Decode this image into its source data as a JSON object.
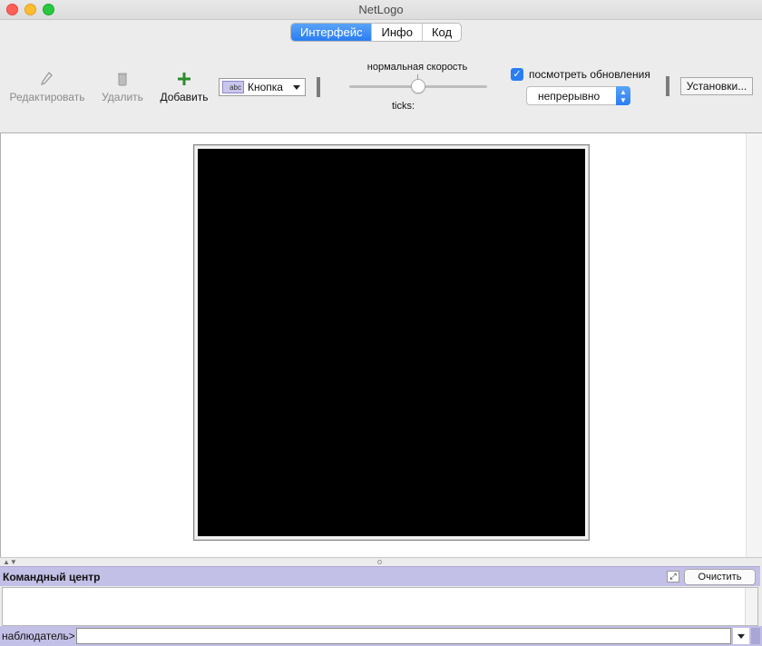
{
  "window": {
    "title": "NetLogo"
  },
  "tabs": [
    {
      "label": "Интерфейс",
      "active": true
    },
    {
      "label": "Инфо",
      "active": false
    },
    {
      "label": "Код",
      "active": false
    }
  ],
  "toolbar": {
    "edit_label": "Редактировать",
    "delete_label": "Удалить",
    "add_label": "Добавить",
    "widget_type": "Кнопка",
    "widget_type_icon_text": "abc",
    "speed_label": "нормальная скорость",
    "speed_value": 0.5,
    "ticks_label": "ticks:",
    "view_updates_label": "посмотреть обновления",
    "view_updates_checked": true,
    "update_mode": "непрерывно",
    "settings_label": "Установки..."
  },
  "command_center": {
    "title": "Командный центр",
    "clear_label": "Очистить",
    "agent_prompt": "наблюдатель>",
    "input_value": ""
  },
  "colors": {
    "world_background": "#000000",
    "tab_active": "#2a7df2",
    "command_center_header": "#c3c0e7",
    "add_icon": "#2e8b2e"
  }
}
